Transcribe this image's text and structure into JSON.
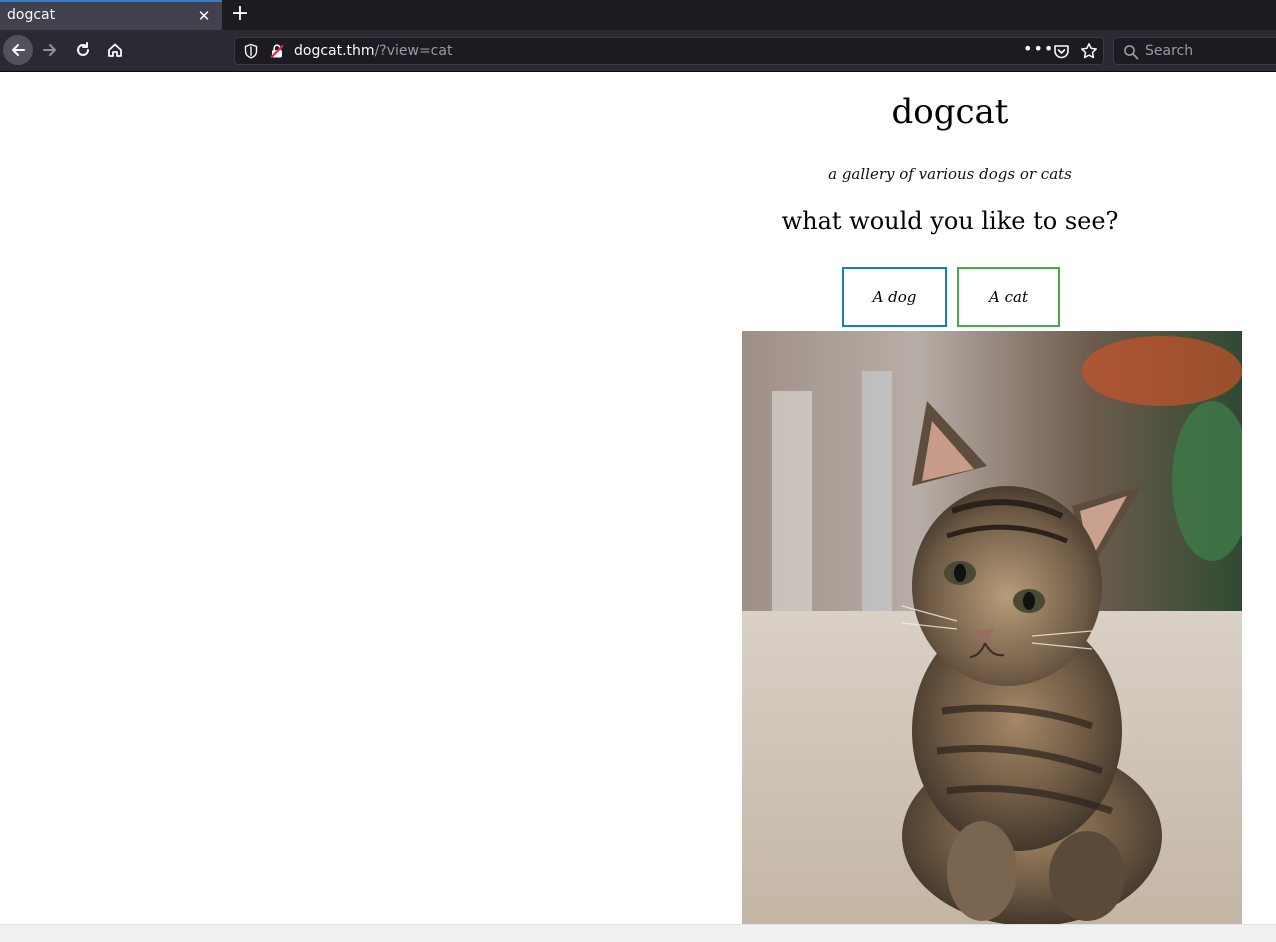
{
  "browser": {
    "tab": {
      "title": "dogcat"
    },
    "url": {
      "host": "dogcat.thm",
      "path": "/?view=cat"
    },
    "search_placeholder": "Search",
    "icons": [
      "back-arrow-icon",
      "forward-arrow-icon",
      "reload-icon",
      "home-icon",
      "shield-icon",
      "insecure-lock-icon",
      "more-icon",
      "pocket-icon",
      "star-icon",
      "search-icon"
    ]
  },
  "page": {
    "title": "dogcat",
    "subtitle": "a gallery of various dogs or cats",
    "question": "what would you like to see?",
    "buttons": {
      "dog": "A dog",
      "cat": "A cat"
    },
    "colors": {
      "dog_border": "#1a7fb5",
      "cat_border": "#4aa947"
    }
  }
}
